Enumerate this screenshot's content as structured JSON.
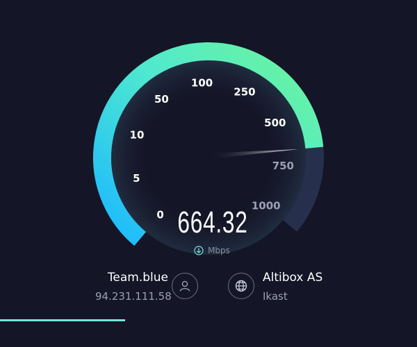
{
  "speedtest": {
    "speed_value": "664.32",
    "unit": "Mbps",
    "direction_icon": "download-arrow-icon",
    "scale_labels": [
      "0",
      "5",
      "10",
      "50",
      "100",
      "250",
      "500",
      "750",
      "1000"
    ],
    "scale_values": [
      0,
      5,
      10,
      50,
      100,
      250,
      500,
      750,
      1000
    ],
    "current_mbps": 664.32,
    "progress": 0.3,
    "colors": {
      "background": "#141526",
      "gradient_start": "#1ab8ff",
      "gradient_mid": "#4fe8d0",
      "gradient_end": "#6df59a",
      "arc_inactive": "#26304d",
      "progress": "#6fe8d8"
    }
  },
  "isp": {
    "name": "Team.blue",
    "ip": "94.231.111.58",
    "icon": "user-icon"
  },
  "server": {
    "name": "Altibox AS",
    "location": "Ikast",
    "icon": "globe-icon"
  }
}
